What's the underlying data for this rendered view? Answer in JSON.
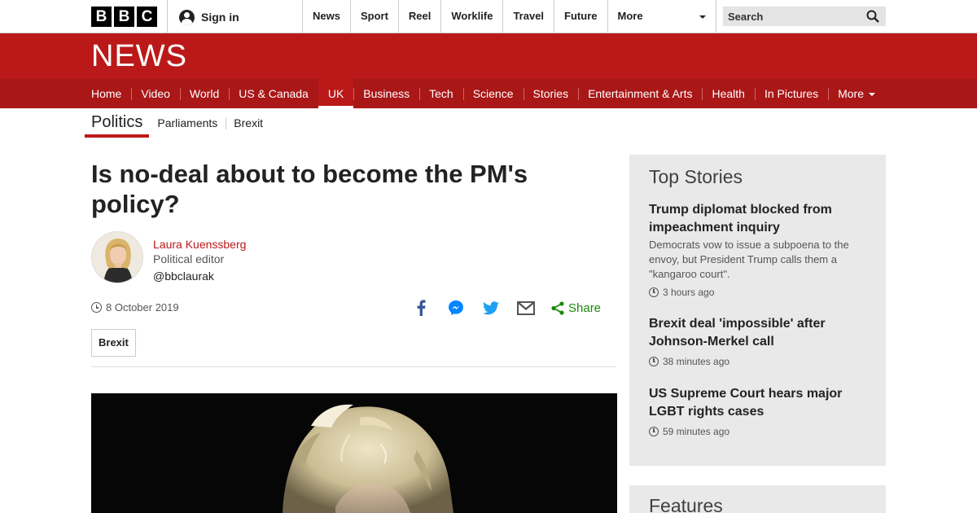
{
  "brand": {
    "logo_letters": [
      "B",
      "B",
      "C"
    ],
    "section_title": "NEWS",
    "colors": {
      "primary_red": "#bb1919",
      "nav_red": "#a91717",
      "share_green": "#1a8a0a"
    }
  },
  "topbar": {
    "signin_label": "Sign in",
    "nav": [
      "News",
      "Sport",
      "Reel",
      "Worklife",
      "Travel",
      "Future"
    ],
    "more_label": "More",
    "search_placeholder": "Search"
  },
  "main_nav": {
    "items": [
      "Home",
      "Video",
      "World",
      "US & Canada",
      "UK",
      "Business",
      "Tech",
      "Science",
      "Stories",
      "Entertainment & Arts",
      "Health",
      "In Pictures"
    ],
    "active": "UK",
    "more_label": "More"
  },
  "sub_nav": {
    "current": "Politics",
    "links": [
      "Parliaments",
      "Brexit"
    ]
  },
  "article": {
    "headline": "Is no-deal about to become the PM's policy?",
    "author": {
      "name": "Laura Kuenssberg",
      "role": "Political editor",
      "handle": "@bbclaurak"
    },
    "date": "8 October 2019",
    "share_label": "Share",
    "share_icons": [
      "facebook-icon",
      "messenger-icon",
      "twitter-icon",
      "email-icon",
      "share-icon"
    ],
    "tag": "Brexit"
  },
  "sidebar": {
    "top_stories_title": "Top Stories",
    "stories": [
      {
        "title": "Trump diplomat blocked from impeachment inquiry",
        "summary": "Democrats vow to issue a subpoena to the envoy, but President Trump calls them a \"kangaroo court\".",
        "time": "3 hours ago"
      },
      {
        "title": "Brexit deal 'impossible' after Johnson-Merkel call",
        "summary": "",
        "time": "38 minutes ago"
      },
      {
        "title": "US Supreme Court hears major LGBT rights cases",
        "summary": "",
        "time": "59 minutes ago"
      }
    ],
    "features_title": "Features"
  }
}
